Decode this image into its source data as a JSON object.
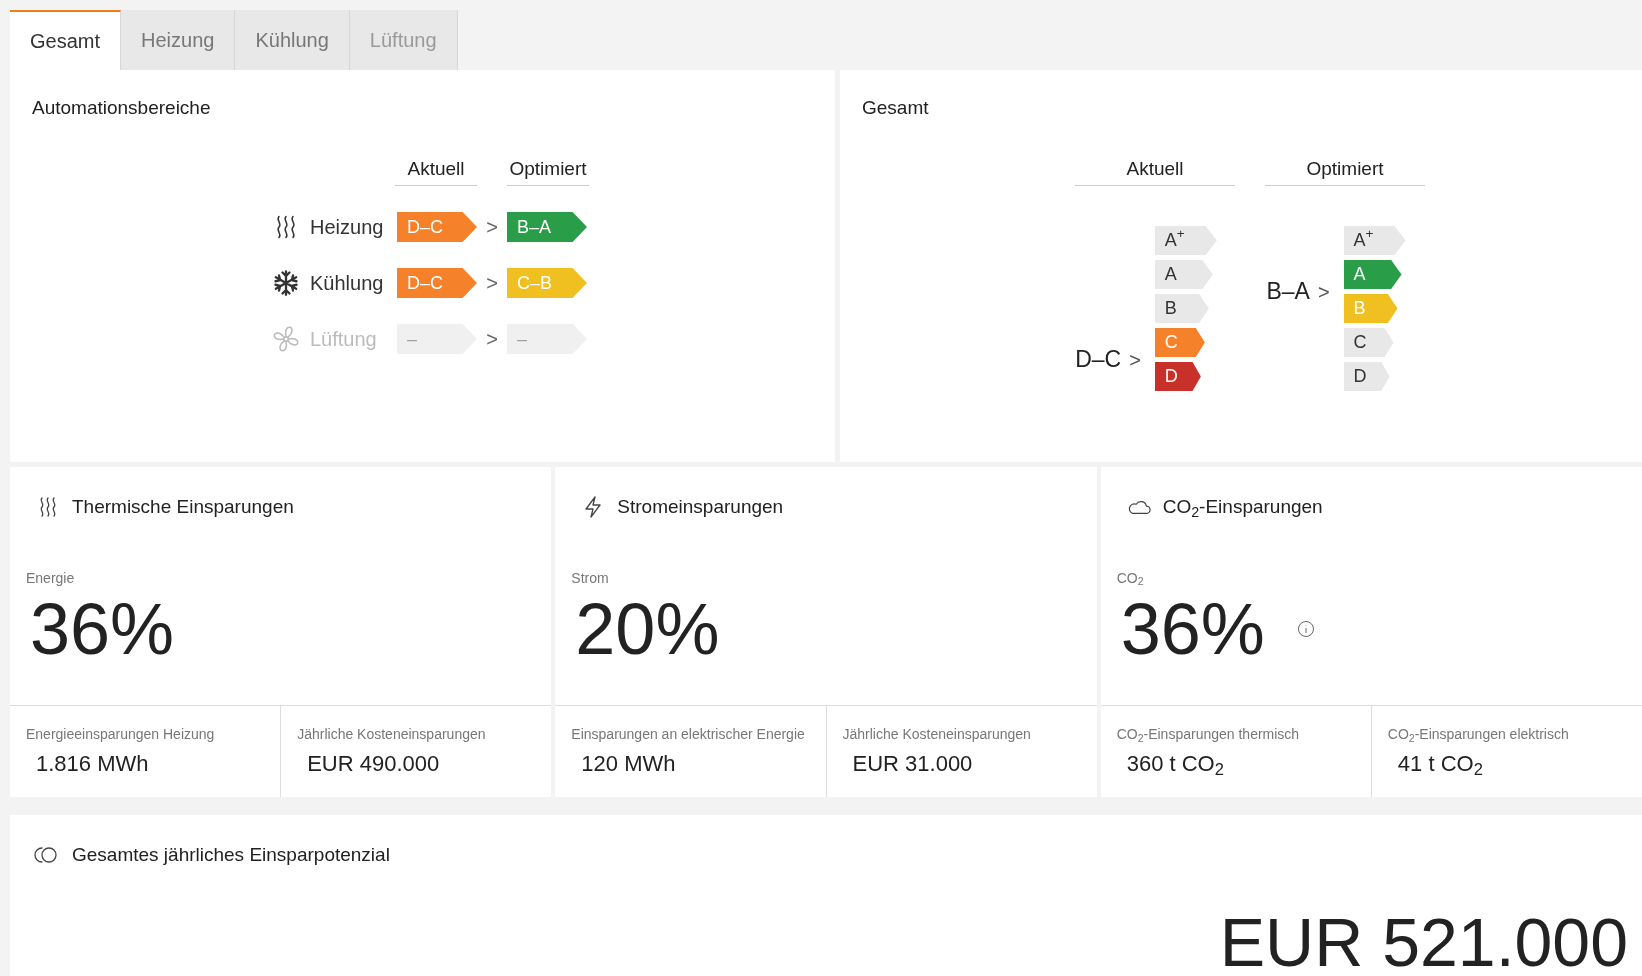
{
  "tabs": [
    {
      "label": "Gesamt",
      "selected": true,
      "disabled": false
    },
    {
      "label": "Heizung",
      "selected": false,
      "disabled": false
    },
    {
      "label": "Kühlung",
      "selected": false,
      "disabled": false
    },
    {
      "label": "Lüftung",
      "selected": false,
      "disabled": true
    }
  ],
  "automation": {
    "title": "Automationsbereiche",
    "columns": [
      "Aktuell",
      "Optimiert"
    ],
    "rows": [
      {
        "kind": "heat",
        "label": "Heizung",
        "disabled": false,
        "current": {
          "text": "D–C",
          "color": "#f5822a"
        },
        "optimized": {
          "text": "B–A",
          "color": "#2a9d48"
        },
        "arrow": ">"
      },
      {
        "kind": "snow",
        "label": "Kühlung",
        "disabled": false,
        "current": {
          "text": "D–C",
          "color": "#f5822a"
        },
        "optimized": {
          "text": "C–B",
          "color": "#f0c020"
        },
        "arrow": ">"
      },
      {
        "kind": "fan",
        "label": "Lüftung",
        "disabled": true,
        "current": {
          "text": "–",
          "color": "#f0f0f0"
        },
        "optimized": {
          "text": "–",
          "color": "#f0f0f0"
        },
        "arrow": ">"
      }
    ]
  },
  "overall": {
    "title": "Gesamt",
    "scales": [
      {
        "heading": "Aktuell",
        "reading": "D–C",
        "arrow": ">",
        "grades": [
          {
            "label": "A$^{+}$",
            "highlighted": false,
            "color": "#e8e8e8"
          },
          {
            "label": "A",
            "highlighted": false,
            "color": "#e8e8e8"
          },
          {
            "label": "B",
            "highlighted": false,
            "color": "#e8e8e8"
          },
          {
            "label": "C",
            "highlighted": true,
            "color": "#f5822a"
          },
          {
            "label": "D",
            "highlighted": true,
            "color": "#c8302a"
          }
        ]
      },
      {
        "heading": "Optimiert",
        "reading": "B–A",
        "arrow": ">",
        "grades": [
          {
            "label": "A$^{+}$",
            "highlighted": false,
            "color": "#e8e8e8"
          },
          {
            "label": "A",
            "highlighted": true,
            "color": "#2a9d48"
          },
          {
            "label": "B",
            "highlighted": true,
            "color": "#f0c020"
          },
          {
            "label": "C",
            "highlighted": false,
            "color": "#e8e8e8"
          },
          {
            "label": "D",
            "highlighted": false,
            "color": "#e8e8e8"
          }
        ]
      }
    ]
  },
  "cards": [
    {
      "kind": "heat",
      "title": "Thermische Einsparungen",
      "metric_label": "Energie",
      "value": "36%",
      "info": false,
      "stats": [
        {
          "label": "Energieeinsparungen Heizung",
          "value": "1.816 MWh"
        },
        {
          "label": "Jährliche Kosteneinsparungen",
          "value": "EUR 490.000"
        }
      ]
    },
    {
      "kind": "bolt",
      "title": "Stromeinsparungen",
      "metric_label": "Strom",
      "value": "20%",
      "info": false,
      "stats": [
        {
          "label": "Einsparungen an elektrischer Energie",
          "value": "120 MWh"
        },
        {
          "label": "Jährliche Kosteneinsparungen",
          "value": "EUR 31.000"
        }
      ]
    },
    {
      "kind": "cloud",
      "title": "CO$_{2}$-Einsparungen",
      "metric_label": "CO$_{2}$",
      "value": "36%",
      "info": true,
      "stats": [
        {
          "label": "CO$_{2}$-Einsparungen thermisch",
          "value": "360 t CO$_{2}$"
        },
        {
          "label": "CO$_{2}$-Einsparungen elektrisch",
          "value": "41 t CO$_{2}$"
        }
      ]
    }
  ],
  "total": {
    "kind": "coins",
    "title": "Gesamtes jährliches Einsparpotenzial",
    "value": "EUR 521.000"
  }
}
